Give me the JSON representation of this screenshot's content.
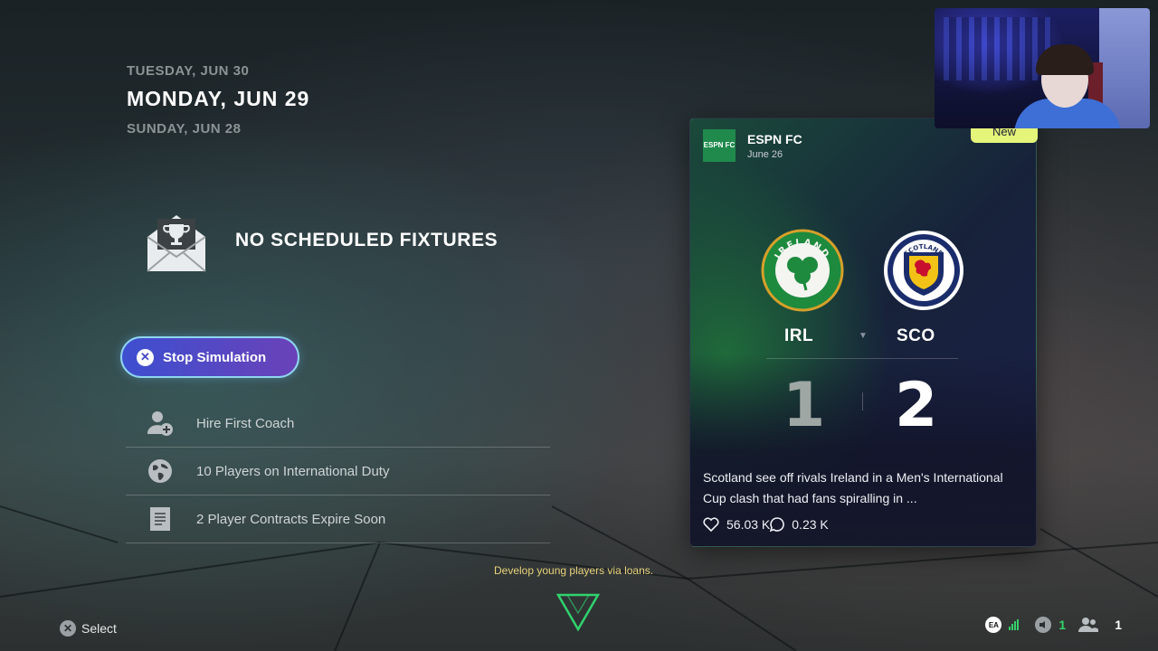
{
  "dates": {
    "next": "TUESDAY, JUN 30",
    "current": "MONDAY, JUN 29",
    "previous": "SUNDAY, JUN 28"
  },
  "fixtures": {
    "empty_message": "NO SCHEDULED FIXTURES"
  },
  "stop_simulation": {
    "label": "Stop Simulation"
  },
  "actions": [
    {
      "label": "Hire First Coach",
      "icon": "add-user-icon"
    },
    {
      "label": "10 Players on International Duty",
      "icon": "globe-icon"
    },
    {
      "label": "2 Player Contracts Expire Soon",
      "icon": "document-icon"
    }
  ],
  "tip": "Develop young players via loans.",
  "bottom_bar": {
    "select_label": "Select",
    "party_count": "1",
    "friends_count": "1"
  },
  "news_card": {
    "source": "ESPN FC",
    "logo_text": "ESPN FC",
    "date": "June 26",
    "badge": "New",
    "home_team": "IRL",
    "away_team": "SCO",
    "home_score": "1",
    "away_score": "2",
    "home_crest_text": "IRELAND",
    "away_crest_text": "SCOTLAND",
    "headline": "Scotland see off rivals Ireland in a Men's International Cup clash that had fans spiralling in ...",
    "likes": "56.03 K",
    "comments": "0.23 K"
  },
  "colors": {
    "accent_green": "#34d36a",
    "button_gradient_start": "#3d4fd0",
    "button_gradient_end": "#6a42b8",
    "tip_text": "#e8d27a",
    "badge_new": "#e4f57a"
  }
}
